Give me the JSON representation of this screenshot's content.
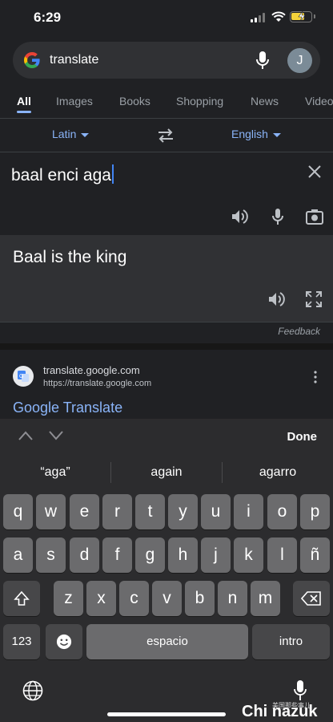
{
  "status_bar": {
    "time": "6:29"
  },
  "search": {
    "query": "translate",
    "avatar_initial": "J"
  },
  "tabs": [
    {
      "label": "All",
      "active": true
    },
    {
      "label": "Images"
    },
    {
      "label": "Books"
    },
    {
      "label": "Shopping"
    },
    {
      "label": "News"
    },
    {
      "label": "Video"
    }
  ],
  "translate": {
    "source_language": "Latin",
    "target_language": "English",
    "input_text": "baal enci aga",
    "output_text": "Baal is the king",
    "feedback_label": "Feedback"
  },
  "result": {
    "site_name": "translate.google.com",
    "site_url": "https://translate.google.com",
    "title": "Google Translate"
  },
  "keyboard": {
    "done_label": "Done",
    "suggestions": [
      "“aga”",
      "again",
      "agarro"
    ],
    "row1": [
      "q",
      "w",
      "e",
      "r",
      "t",
      "y",
      "u",
      "i",
      "o",
      "p"
    ],
    "row2": [
      "a",
      "s",
      "d",
      "f",
      "g",
      "h",
      "j",
      "k",
      "l",
      "ñ"
    ],
    "row3": [
      "z",
      "x",
      "c",
      "v",
      "b",
      "n",
      "m"
    ],
    "numbers_label": "123",
    "space_label": "espacio",
    "return_label": "intro"
  },
  "watermark": {
    "text": "Chi nazuk",
    "small_text": "美国那些事儿"
  },
  "colors": {
    "accent": "#8ab4f8",
    "background": "#202124",
    "surface": "#303134",
    "key": "#6b6b6d"
  }
}
